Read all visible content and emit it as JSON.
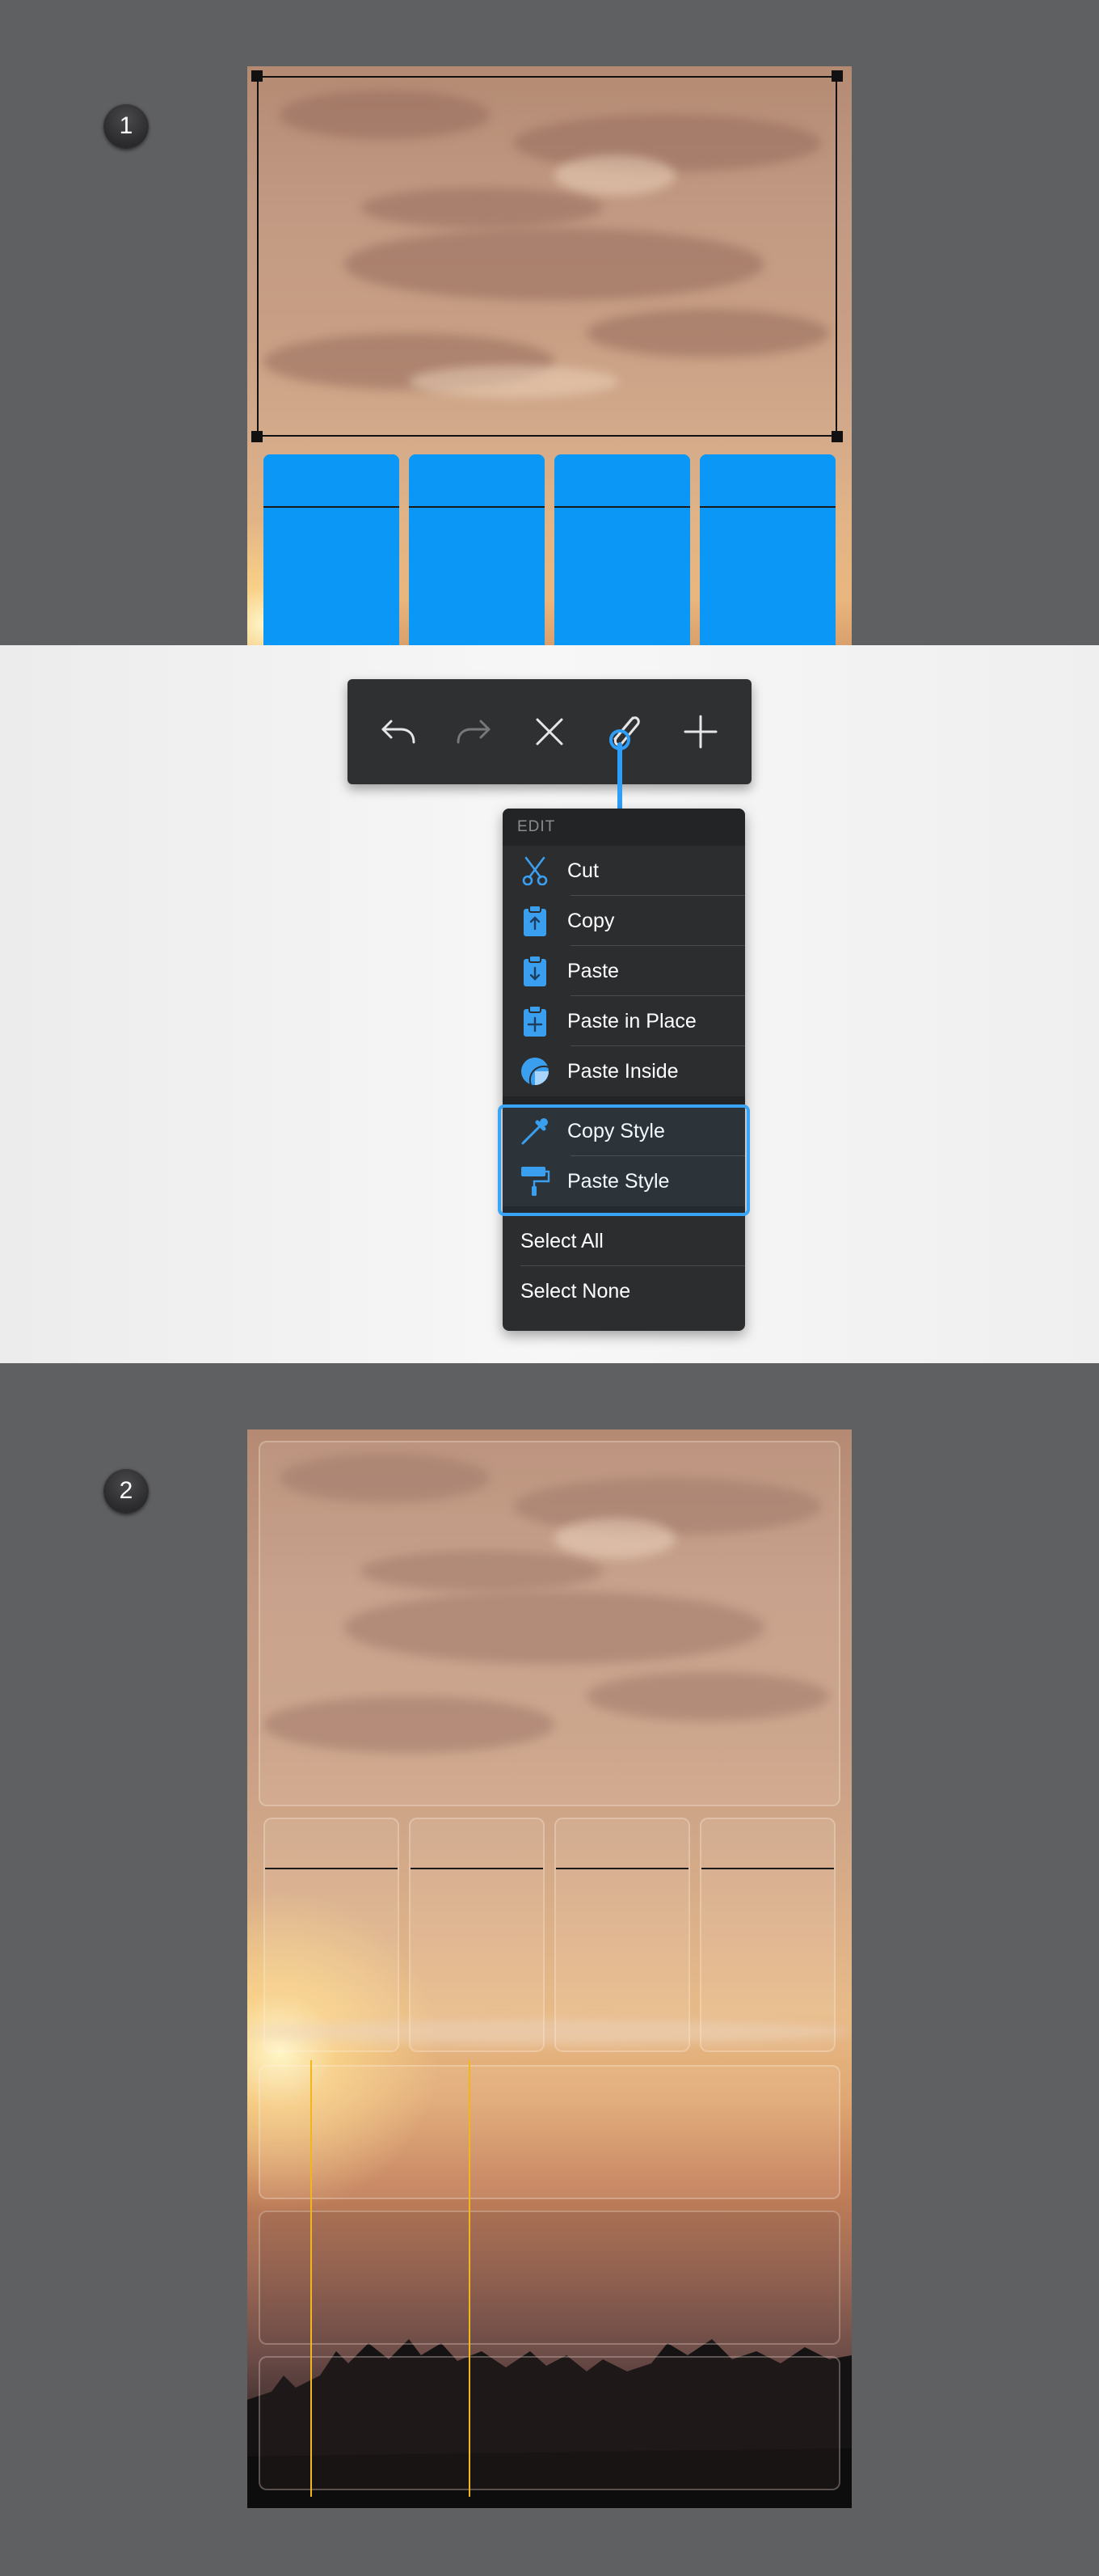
{
  "steps": {
    "first": "1",
    "second": "2"
  },
  "toolbar": {
    "buttons": [
      {
        "name": "undo",
        "icon": "undo-icon",
        "enabled": true
      },
      {
        "name": "redo",
        "icon": "redo-icon",
        "enabled": false
      },
      {
        "name": "delete",
        "icon": "close-icon",
        "enabled": true
      },
      {
        "name": "edit",
        "icon": "paperclip-icon",
        "enabled": true,
        "active": true
      },
      {
        "name": "add",
        "icon": "plus-icon",
        "enabled": true
      }
    ]
  },
  "menu": {
    "header": "EDIT",
    "items": [
      {
        "label": "Cut",
        "icon": "scissors-icon"
      },
      {
        "label": "Copy",
        "icon": "copy-clipboard-icon"
      },
      {
        "label": "Paste",
        "icon": "paste-clipboard-icon"
      },
      {
        "label": "Paste in Place",
        "icon": "paste-in-place-icon"
      },
      {
        "label": "Paste Inside",
        "icon": "paste-inside-icon"
      },
      {
        "label": "Copy Style",
        "icon": "eyedropper-icon",
        "highlighted": true
      },
      {
        "label": "Paste Style",
        "icon": "paint-roller-icon",
        "highlighted": true
      },
      {
        "label": "Select All"
      },
      {
        "label": "Select None"
      }
    ]
  },
  "colors": {
    "background": "#5f6062",
    "accent_blue": "#0a97f5",
    "highlight": "#3aa4f6",
    "guide_yellow": "#f2b51a",
    "menu_bg": "#2c2d2f"
  }
}
